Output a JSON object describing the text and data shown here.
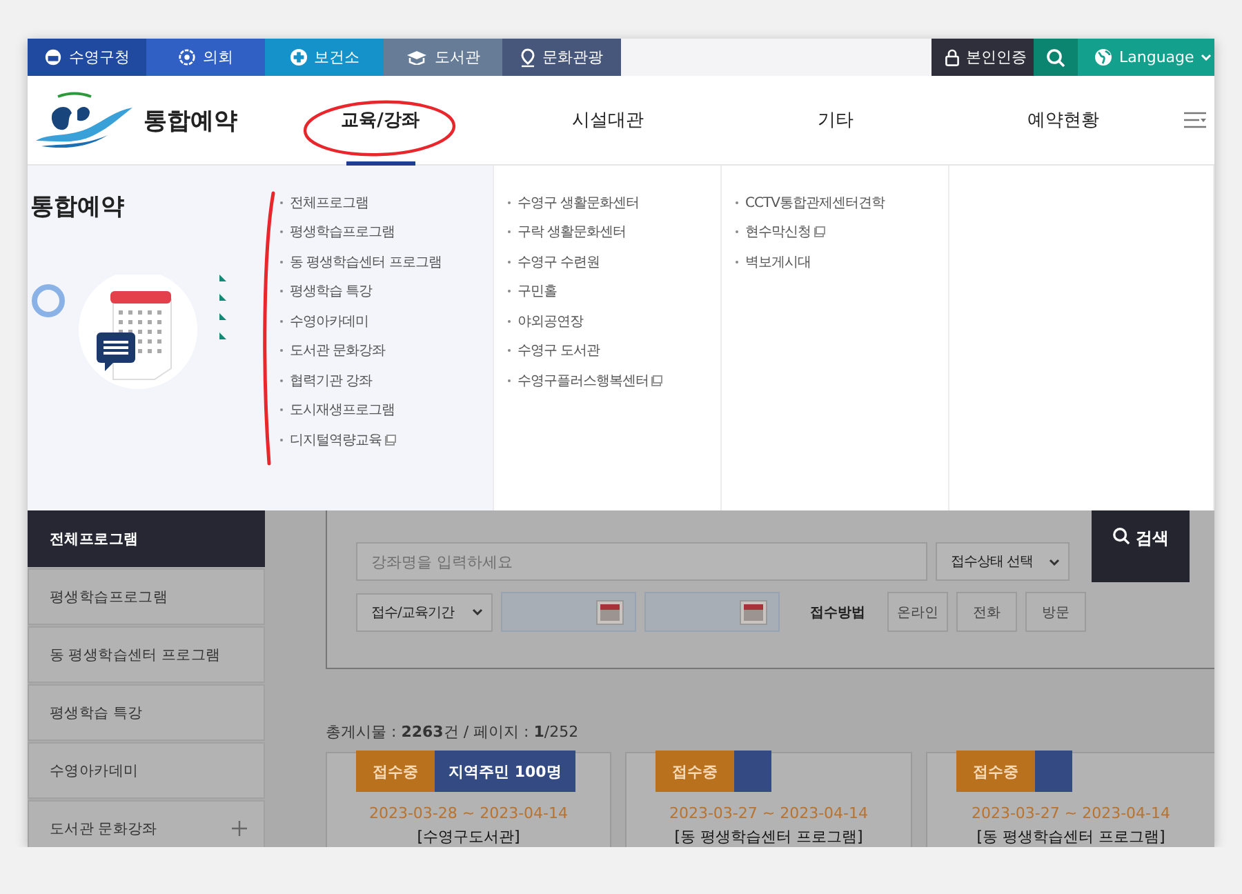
{
  "top_bar": {
    "sites": [
      {
        "label": "수영구청",
        "kind": "emblem",
        "color": "#1f4aa0"
      },
      {
        "label": "의회",
        "kind": "flower",
        "color": "#3160c4"
      },
      {
        "label": "보건소",
        "kind": "cross",
        "color": "#1592c9"
      },
      {
        "label": "도서관",
        "kind": "book",
        "color": "#667c97"
      },
      {
        "label": "문화관광",
        "kind": "pin",
        "color": "#47577c"
      }
    ],
    "auth_button": "본인인증",
    "language_button": "Language"
  },
  "header": {
    "title": "통합예약",
    "nav": [
      {
        "label": "교육/강좌",
        "selected": true
      },
      {
        "label": "시설대관",
        "selected": false
      },
      {
        "label": "기타",
        "selected": false
      },
      {
        "label": "예약현황",
        "selected": false
      }
    ]
  },
  "mega_menu": {
    "title": "통합예약",
    "columns": [
      [
        {
          "label": "전체프로그램",
          "external": false
        },
        {
          "label": "평생학습프로그램",
          "external": false
        },
        {
          "label": "동 평생학습센터 프로그램",
          "external": false
        },
        {
          "label": "평생학습 특강",
          "external": false
        },
        {
          "label": "수영아카데미",
          "external": false
        },
        {
          "label": "도서관 문화강좌",
          "external": false
        },
        {
          "label": "협력기관 강좌",
          "external": false
        },
        {
          "label": "도시재생프로그램",
          "external": false
        },
        {
          "label": "디지털역량교육",
          "external": true
        }
      ],
      [
        {
          "label": "수영구 생활문화센터",
          "external": false
        },
        {
          "label": "구락 생활문화센터",
          "external": false
        },
        {
          "label": "수영구 수련원",
          "external": false
        },
        {
          "label": "구민홀",
          "external": false
        },
        {
          "label": "야외공연장",
          "external": false
        },
        {
          "label": "수영구 도서관",
          "external": false
        },
        {
          "label": "수영구플러스행복센터",
          "external": true
        }
      ],
      [
        {
          "label": "CCTV통합관제센터견학",
          "external": false
        },
        {
          "label": "현수막신청",
          "external": true
        },
        {
          "label": "벽보게시대",
          "external": false
        }
      ],
      []
    ]
  },
  "sidebar": {
    "items": [
      {
        "label": "전체프로그램",
        "selected": true,
        "expandable": false
      },
      {
        "label": "평생학습프로그램",
        "selected": false,
        "expandable": false
      },
      {
        "label": "동 평생학습센터 프로그램",
        "selected": false,
        "expandable": false
      },
      {
        "label": "평생학습 특강",
        "selected": false,
        "expandable": false
      },
      {
        "label": "수영아카데미",
        "selected": false,
        "expandable": false
      },
      {
        "label": "도서관 문화강좌",
        "selected": false,
        "expandable": true
      }
    ]
  },
  "search": {
    "keyword": {
      "placeholder": "강좌명을 입력하세요"
    },
    "status_select": "접수상태 선택",
    "period_select": "접수/교육기간",
    "method_label": "접수방법",
    "methods": [
      "온라인",
      "전화",
      "방문"
    ],
    "search_button": "검색"
  },
  "summary": "총게시물 : **2263**건 / 페이지 : **1**/252",
  "cards": [
    {
      "status": "접수중",
      "target": "지역주민 100명",
      "dates": "2023-03-28 ~ 2023-04-14",
      "title": "[수영구도서관]"
    },
    {
      "status": "접수중",
      "dates": "2023-03-27 ~ 2023-04-14",
      "title": "[동 평생학습센터 프로그램]"
    },
    {
      "status": "접수중",
      "dates": "2023-03-27 ~ 2023-04-14",
      "title": "[동 평생학습센터 프로그램]"
    }
  ]
}
